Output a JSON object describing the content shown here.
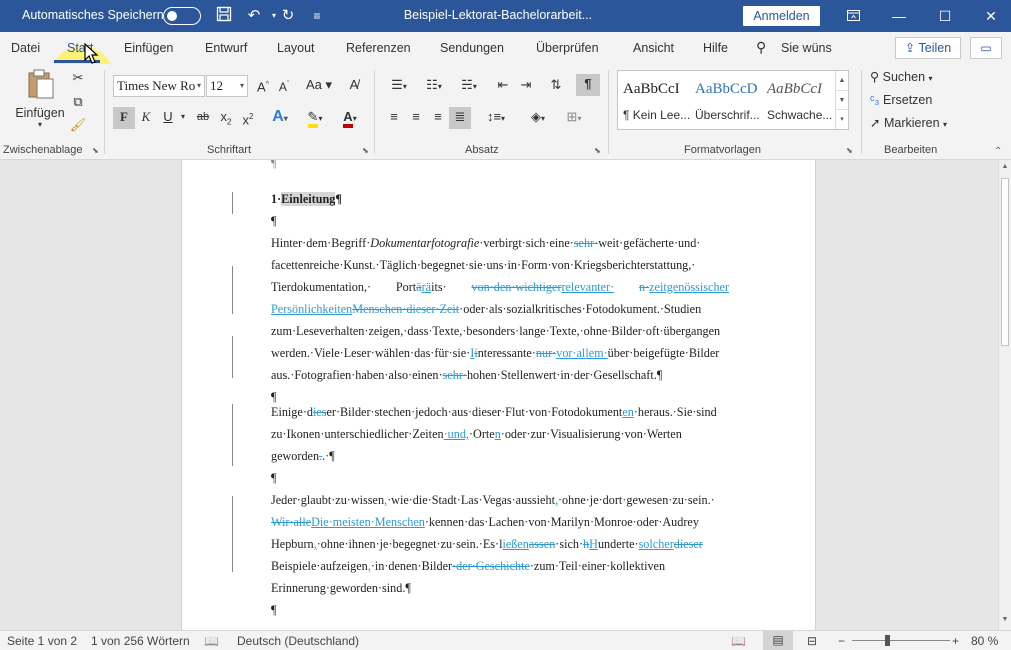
{
  "titlebar": {
    "autosave_label": "Automatisches Speichern",
    "document_title": "Beispiel-Lektorat-Bachelorarbeit...",
    "signin_label": "Anmelden",
    "bg_color": "#2b579a"
  },
  "menu": {
    "tabs": [
      "Datei",
      "Start",
      "Einfügen",
      "Entwurf",
      "Layout",
      "Referenzen",
      "Sendungen",
      "Überprüfen",
      "Ansicht",
      "Hilfe"
    ],
    "search_label": "Sie wüns",
    "share_label": "Teilen"
  },
  "ribbon": {
    "clipboard": {
      "paste_label": "Einfügen",
      "group_label": "Zwischenablage"
    },
    "font": {
      "family": "Times New Ro",
      "size": "12",
      "bold_label": "F",
      "italic_label": "K",
      "underline_label": "U",
      "group_label": "Schriftart"
    },
    "paragraph": {
      "group_label": "Absatz"
    },
    "styles": {
      "items": [
        {
          "sample": "AaBbCcI",
          "name": "¶ Kein Lee..."
        },
        {
          "sample": "AaBbCcD",
          "name": "Überschrif..."
        },
        {
          "sample": "AaBbCcI",
          "name": "Schwache..."
        }
      ],
      "group_label": "Formatvorlagen"
    },
    "editing": {
      "find_label": "Suchen",
      "replace_label": "Ersetzen",
      "select_label": "Markieren",
      "group_label": "Bearbeiten"
    }
  },
  "document": {
    "heading_number": "1",
    "heading_text": "Einleitung",
    "pilcrow": "¶",
    "accent_insert_color": "#2e9ad0"
  },
  "statusbar": {
    "page": "Seite 1 von 2",
    "words": "1 von 256 Wörtern",
    "language": "Deutsch (Deutschland)",
    "zoom": "80 %"
  }
}
